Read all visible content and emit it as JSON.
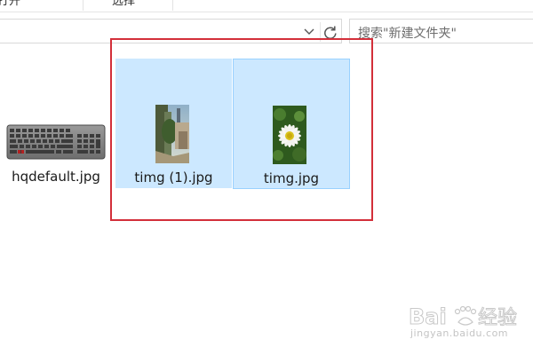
{
  "ribbon": {
    "items": [
      "打开",
      "选择"
    ]
  },
  "address": {
    "path": "",
    "search_placeholder": "搜索\"新建文件夹\""
  },
  "files": [
    {
      "name": "hqdefault.jpg",
      "selected": false,
      "thumb": "keyboard-thumbnail"
    },
    {
      "name": "timg (1).jpg",
      "selected": true,
      "thumb": "tower-street-thumbnail"
    },
    {
      "name": "timg.jpg",
      "selected": true,
      "thumb": "daisy-flower-thumbnail"
    }
  ],
  "annotation": {
    "color": "#d32f3a"
  },
  "colors": {
    "selection": "#cce8ff",
    "selection_border": "#99d1ff"
  },
  "watermark": {
    "brand": "Baidu",
    "brand_cn": "经验",
    "url": "jingyan.baidu.com"
  }
}
